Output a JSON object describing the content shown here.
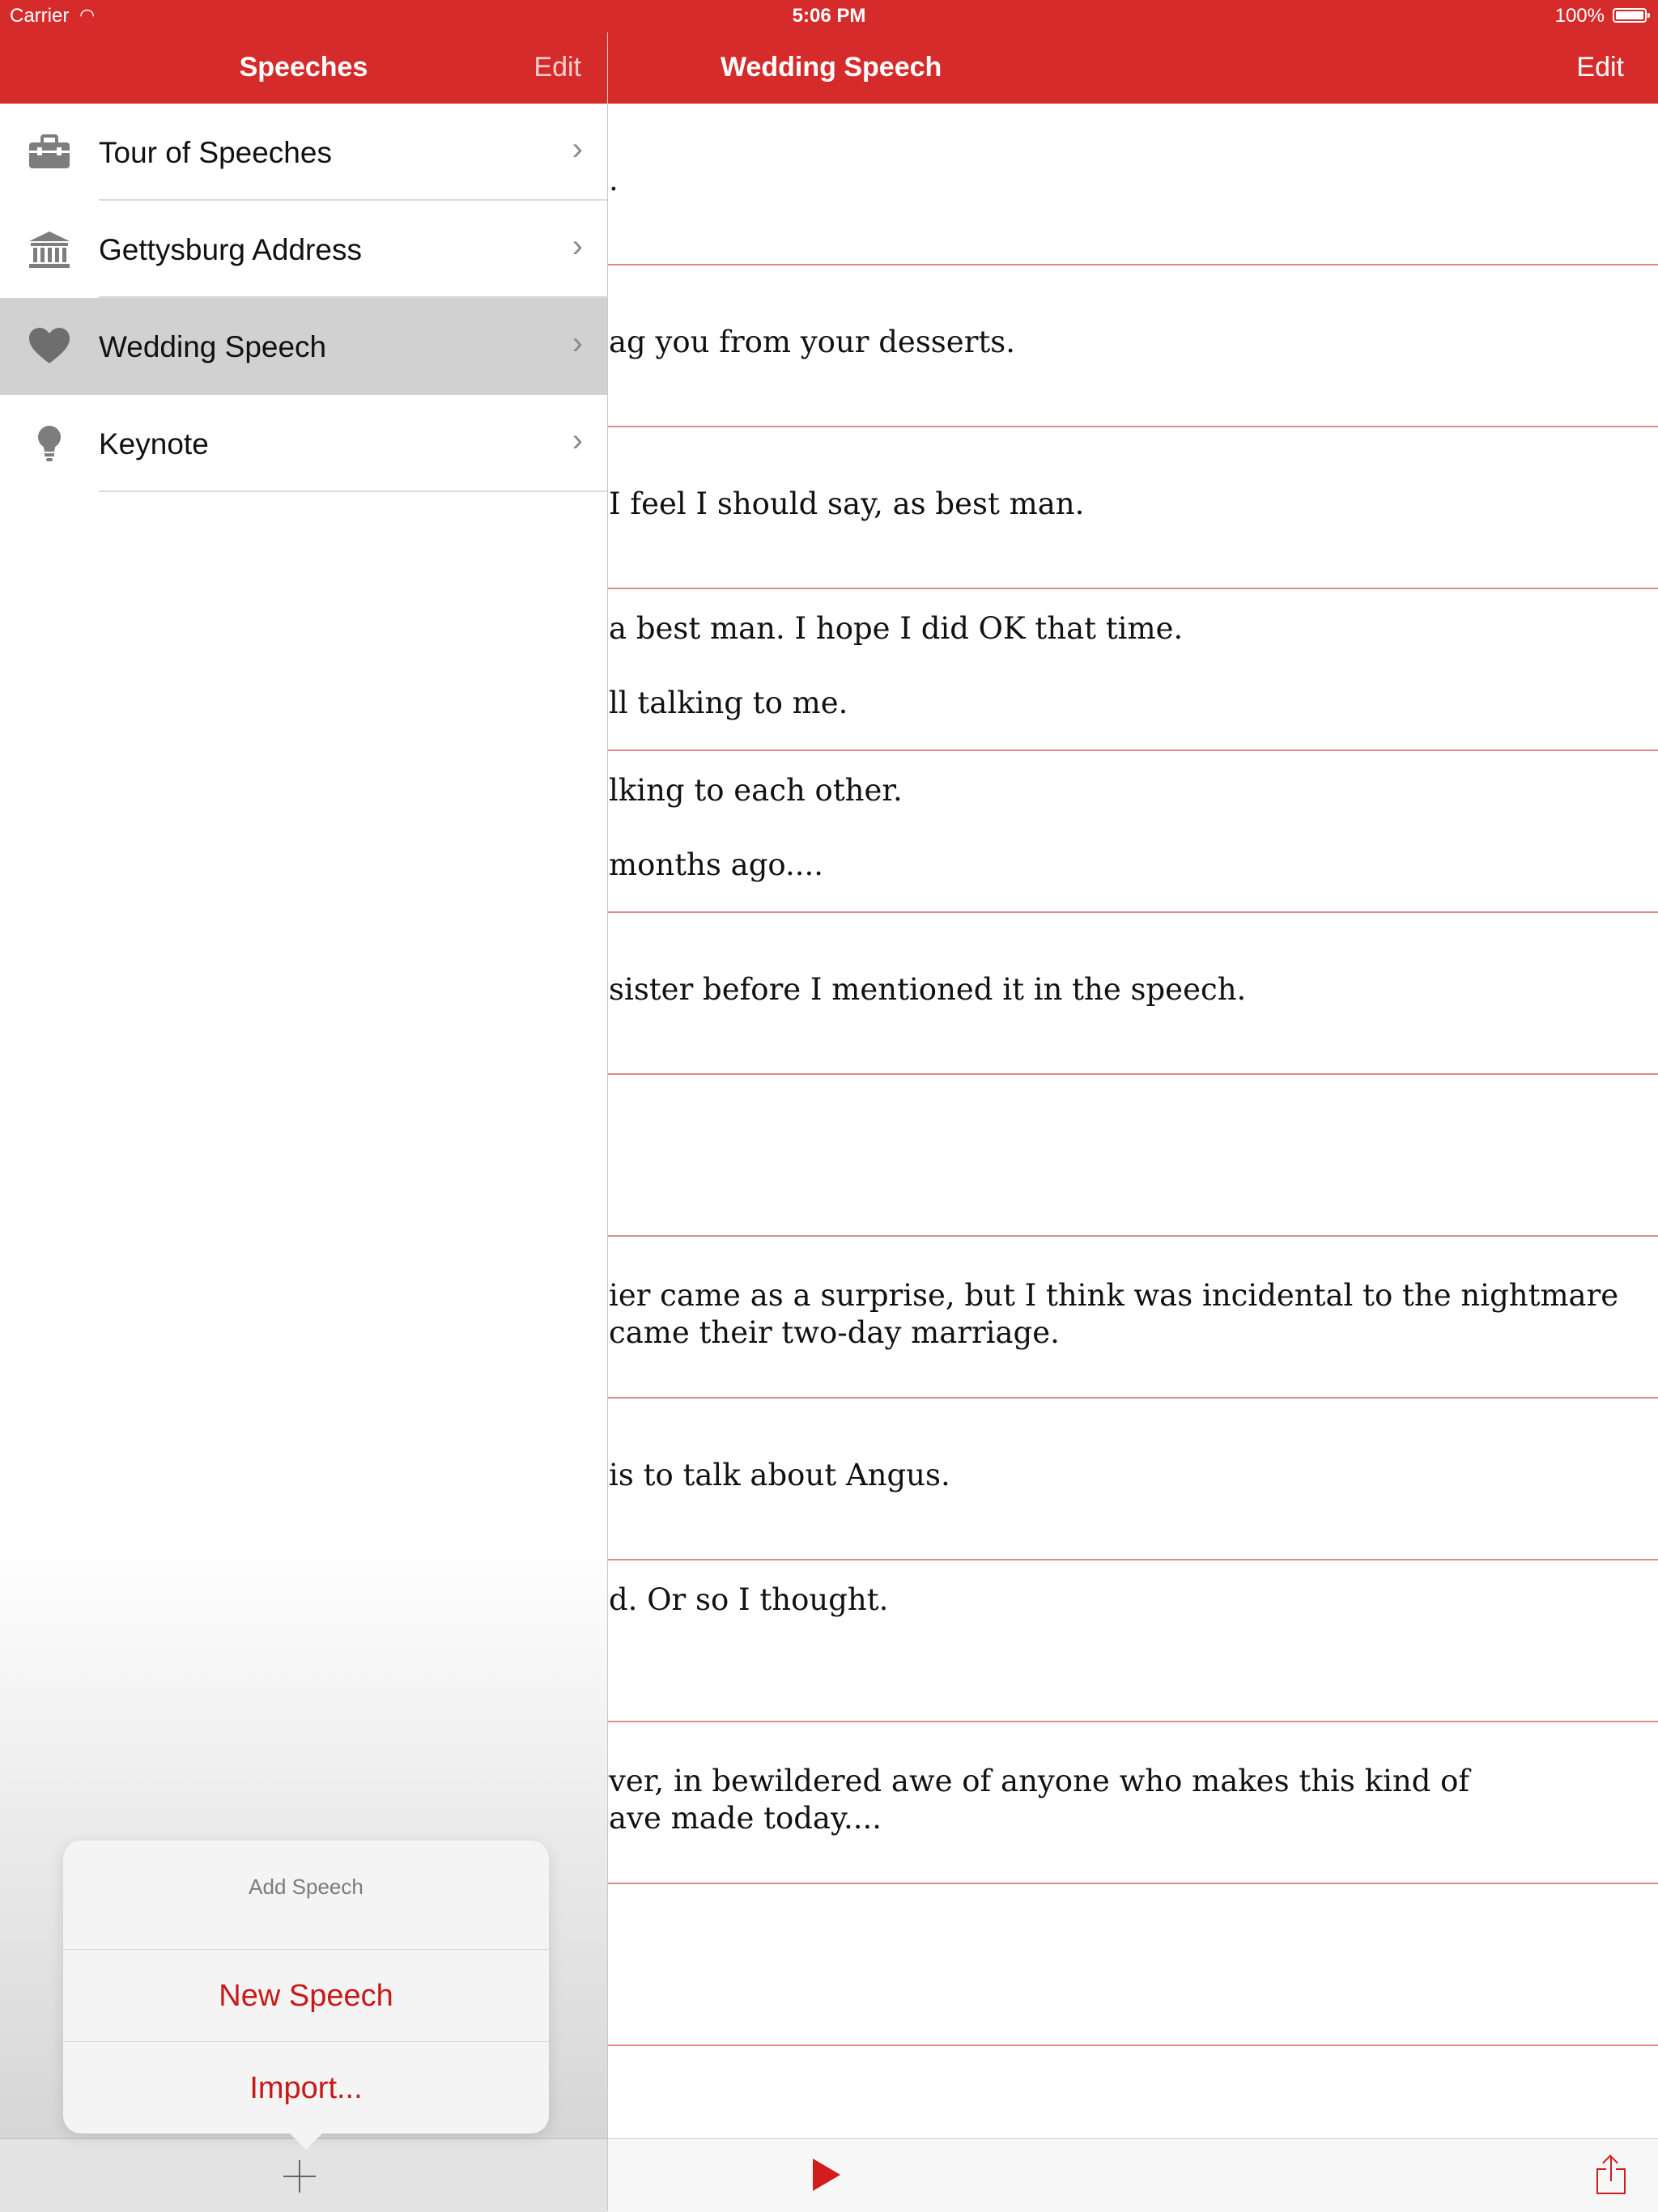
{
  "status_bar": {
    "carrier": "Carrier",
    "time": "5:06 PM",
    "battery": "100%"
  },
  "master": {
    "title": "Speeches",
    "edit_label": "Edit",
    "items": [
      {
        "label": "Tour of Speeches",
        "icon": "briefcase-icon"
      },
      {
        "label": "Gettysburg Address",
        "icon": "building-icon"
      },
      {
        "label": "Wedding Speech",
        "icon": "heart-icon",
        "selected": true
      },
      {
        "label": "Keynote",
        "icon": "lightbulb-icon"
      }
    ]
  },
  "popover": {
    "title": "Add Speech",
    "new_speech": "New Speech",
    "import": "Import..."
  },
  "detail": {
    "title": "Wedding Speech",
    "edit_label": "Edit",
    "lines": [
      {
        "l1": ".",
        "l2": ""
      },
      {
        "l1": "ag you from your desserts.",
        "l2": ""
      },
      {
        "l1": "I feel I should say, as best man.",
        "l2": ""
      },
      {
        "l1": "a best man. I hope I did OK that time.",
        "l2": "ll talking to me."
      },
      {
        "l1": "lking to each other.",
        "l2": "months ago...."
      },
      {
        "l1": "sister before I mentioned it in the speech.",
        "l2": ""
      },
      {
        "l1": "",
        "l2": ""
      },
      {
        "l1": "ier came as a surprise, but I think was incidental to the nightmare",
        "l2": "came their two-day marriage."
      },
      {
        "l1": "is to talk about Angus.",
        "l2": ""
      },
      {
        "l1": "d. Or so I thought.",
        "l2": ""
      },
      {
        "l1": "ver, in bewildered awe of anyone who makes this kind of",
        "l2": "ave made today...."
      },
      {
        "l1": "",
        "l2": ""
      },
      {
        "l1": "",
        "l2": ""
      }
    ]
  },
  "colors": {
    "accent": "#d52b2b",
    "action_text": "#c81818",
    "rule_line": "#dc8c8c"
  }
}
